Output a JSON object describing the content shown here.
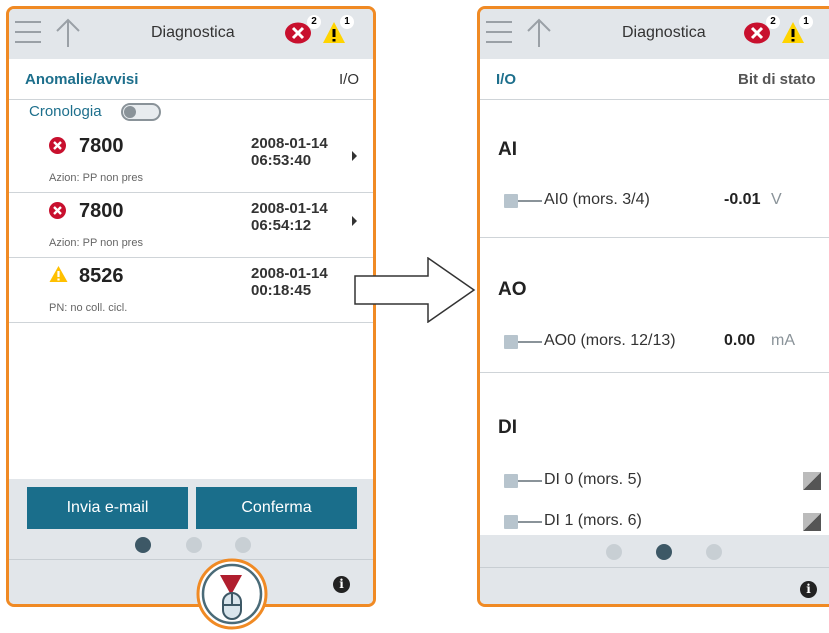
{
  "left_screen": {
    "title": "Diagnostica",
    "error_count": "2",
    "warning_count": "1",
    "tabs": {
      "active": "Anomalie/avvisi",
      "other": "I/O"
    },
    "history_label": "Cronologia",
    "history_toggle": "off",
    "alarms": [
      {
        "type": "error",
        "code": "7800",
        "date": "2008-01-14",
        "time": "06:53:40",
        "desc": "Azion: PP non pres"
      },
      {
        "type": "error",
        "code": "7800",
        "date": "2008-01-14",
        "time": "06:54:12",
        "desc": "Azion: PP non pres"
      },
      {
        "type": "warning",
        "code": "8526",
        "date": "2008-01-14",
        "time": "00:18:45",
        "desc": "PN: no coll. cicl."
      }
    ],
    "buttons": {
      "email": "Invia e-mail",
      "confirm": "Conferma"
    },
    "active_page": 1,
    "info_glyph": "i"
  },
  "right_screen": {
    "title": "Diagnostica",
    "error_count": "2",
    "warning_count": "1",
    "tabs": {
      "active": "I/O",
      "other": "Bit di stato"
    },
    "sections": {
      "ai": {
        "heading": "AI",
        "label": "AI0 (mors. 3/4)",
        "value": "-0.01",
        "unit": "V"
      },
      "ao": {
        "heading": "AO",
        "label": "AO0 (mors. 12/13)",
        "value": "0.00",
        "unit": "mA"
      },
      "di": {
        "heading": "DI",
        "items": [
          "DI 0 (mors. 5)",
          "DI 1 (mors. 6)"
        ]
      }
    },
    "active_page": 2,
    "info_glyph": "i"
  },
  "colors": {
    "frame": "#f08a24",
    "accent": "#1d6f8c",
    "button": "#1a6e8b",
    "error": "#c8102e",
    "warning": "#ffd400"
  }
}
